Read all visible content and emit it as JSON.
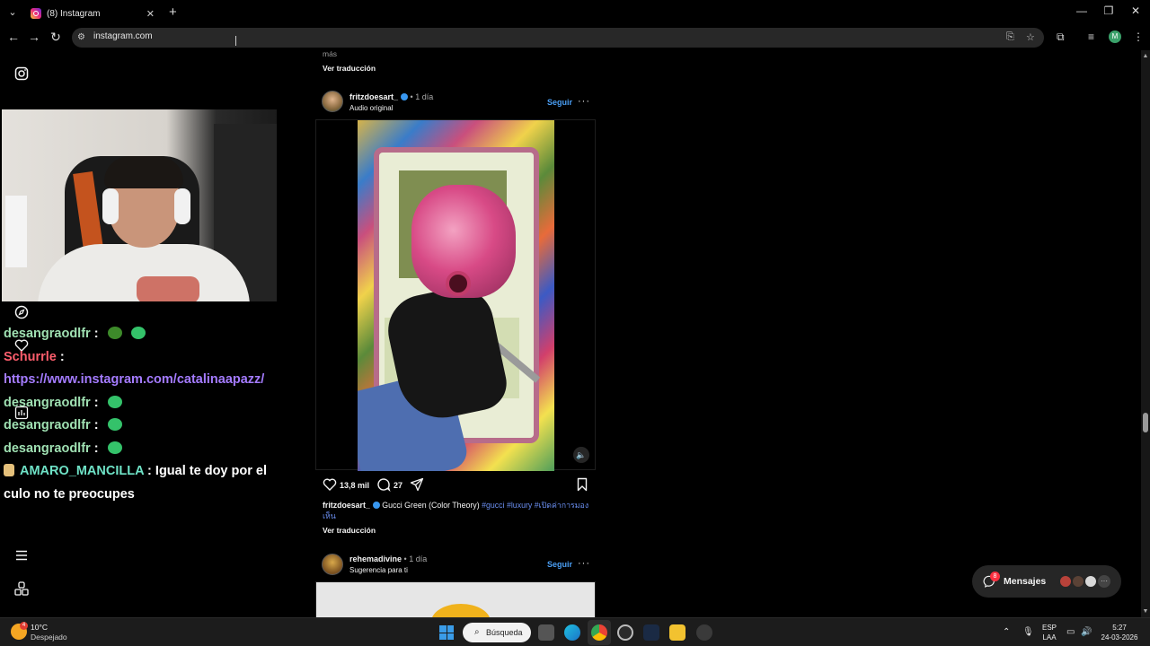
{
  "browser": {
    "tab_title": "(8) Instagram",
    "new_tab_label": "+",
    "url": "instagram.com",
    "profile_initial": "M"
  },
  "ig_nav": {
    "icons": [
      "instagram-logo-icon",
      "compass-icon",
      "heart-icon",
      "stats-icon",
      "menu-icon",
      "apps-icon"
    ]
  },
  "chat": {
    "messages": [
      {
        "user": "desangraodlfr",
        "sep": ":",
        "text": ""
      },
      {
        "user": "Schurrle",
        "sep": ":",
        "text": ""
      },
      {
        "user": "",
        "sep": "",
        "text": "https://www.instagram.com/catalinaapazz/"
      },
      {
        "user": "desangraodlfr",
        "sep": ":",
        "text": ""
      },
      {
        "user": "desangraodlfr",
        "sep": ":",
        "text": ""
      },
      {
        "user": "desangraodlfr",
        "sep": ":",
        "text": ""
      },
      {
        "user": "AMARO_MANCILLA",
        "sep": ":",
        "text": "Igual te doy por el culo no te preocupes"
      }
    ]
  },
  "feed": {
    "prev_more": "más",
    "prev_translate": "Ver traducción",
    "post1": {
      "username": "fritzdoesart_",
      "time": "1 día",
      "subline": "Audio original",
      "follow": "Seguir",
      "more": "···",
      "likes": "13,8 mil",
      "comments": "27",
      "caption_user": "fritzdoesart_",
      "caption_text": "Gucci Green (Color Theory)",
      "caption_tags": "#gucci #luxury #เปิดค่าการมองเห็น",
      "translate": "Ver traducción"
    },
    "post2": {
      "username": "rehemadivine",
      "time": "1 día",
      "subline": "Sugerencia para ti",
      "follow": "Seguir",
      "more": "···"
    }
  },
  "messages": {
    "label": "Mensajes",
    "badge": "8",
    "more": "···"
  },
  "taskbar": {
    "temp": "10°C",
    "weather": "Despejado",
    "weather_badge": "4",
    "search_label": "Búsqueda",
    "lang_top": "ESP",
    "lang_bottom": "LAA",
    "time": "5:27",
    "date": "24-03-2026"
  },
  "colors": {
    "accent_link": "#4a9ff5",
    "chat_green": "#9fe0b2",
    "chat_red": "#ff5e6d",
    "chat_cyan": "#6fe3c7",
    "chat_link": "#a47bff"
  }
}
